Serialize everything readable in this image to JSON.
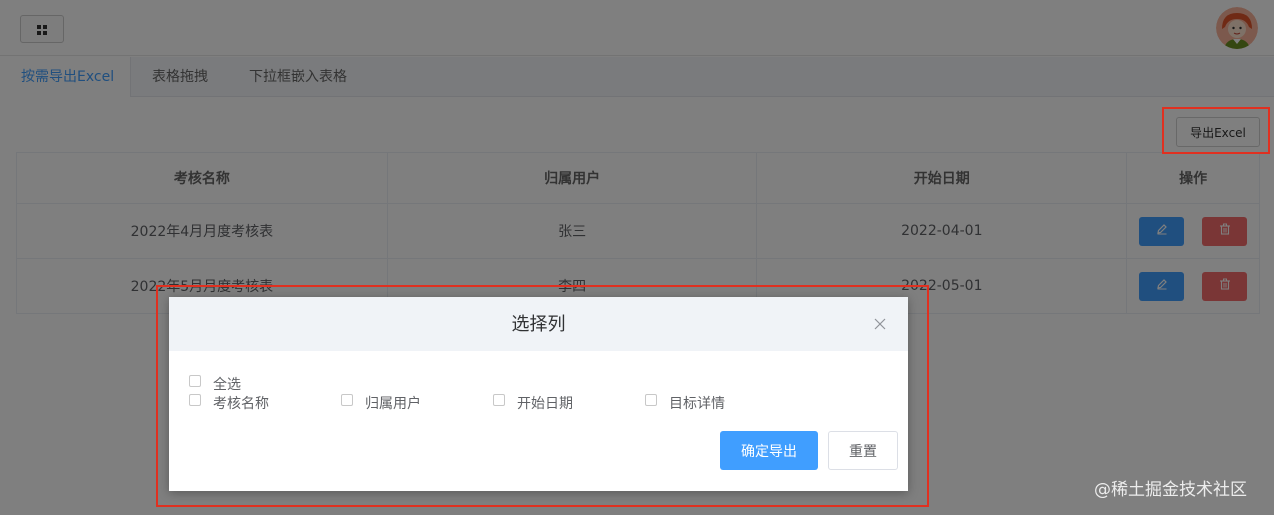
{
  "header": {
    "menu_icon": "grid-icon",
    "avatar_icon": "user-avatar-icon"
  },
  "tabs": [
    {
      "label": "按需导出Excel",
      "active": true
    },
    {
      "label": "表格拖拽",
      "active": false
    },
    {
      "label": "下拉框嵌入表格",
      "active": false
    }
  ],
  "toolbar": {
    "export_label": "导出Excel"
  },
  "table": {
    "columns": [
      "考核名称",
      "归属用户",
      "开始日期",
      "操作"
    ],
    "rows": [
      {
        "name": "2022年4月月度考核表",
        "user": "张三",
        "date": "2022-04-01"
      },
      {
        "name": "2022年5月月度考核表",
        "user": "李四",
        "date": "2022-05-01"
      }
    ],
    "edit_icon": "pencil-icon",
    "delete_icon": "trash-icon"
  },
  "dialog": {
    "title": "选择列",
    "select_all": "全选",
    "options": [
      "考核名称",
      "归属用户",
      "开始日期",
      "目标详情"
    ],
    "confirm_label": "确定导出",
    "reset_label": "重置"
  },
  "watermark": "@稀土掘金技术社区",
  "colors": {
    "primary": "#409eff",
    "danger": "#f56c6c",
    "annotation": "#e03020"
  }
}
